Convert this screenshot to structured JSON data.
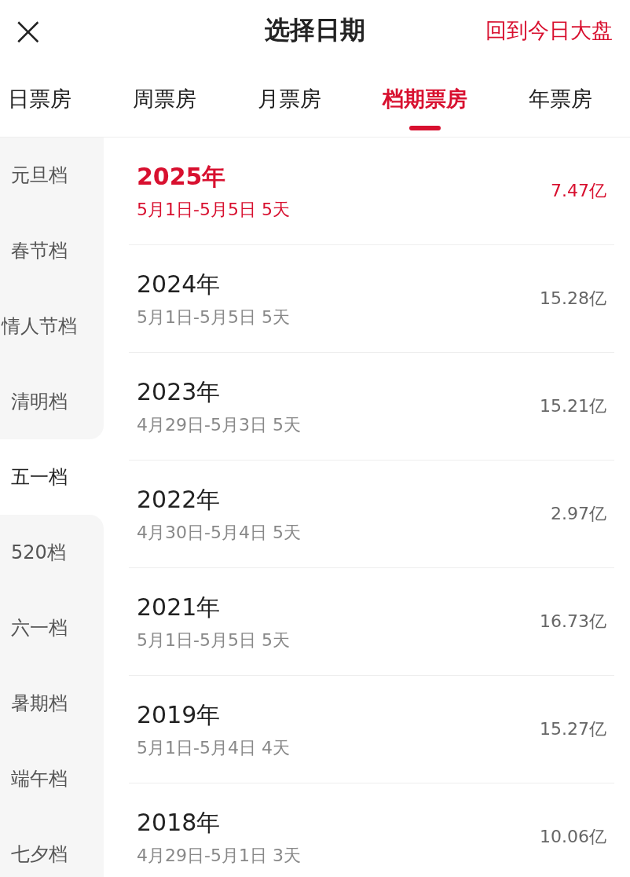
{
  "header": {
    "close": "×",
    "title": "选择日期",
    "link": "回到今日大盘"
  },
  "tabs": [
    {
      "label": "日票房",
      "selected": false
    },
    {
      "label": "周票房",
      "selected": false
    },
    {
      "label": "月票房",
      "selected": false
    },
    {
      "label": "档期票房",
      "selected": true
    },
    {
      "label": "年票房",
      "selected": false
    }
  ],
  "sidebar": {
    "items": [
      {
        "label": "元旦档",
        "selected": false
      },
      {
        "label": "春节档",
        "selected": false
      },
      {
        "label": "情人节档",
        "selected": false
      },
      {
        "label": "清明档",
        "selected": false
      },
      {
        "label": "五一档",
        "selected": true
      },
      {
        "label": "520档",
        "selected": false
      },
      {
        "label": "六一档",
        "selected": false
      },
      {
        "label": "暑期档",
        "selected": false
      },
      {
        "label": "端午档",
        "selected": false
      },
      {
        "label": "七夕档",
        "selected": false
      }
    ]
  },
  "rows": [
    {
      "year": "2025年",
      "dates": "5月1日-5月5日 5天",
      "box_office": "7.47亿",
      "selected": true
    },
    {
      "year": "2024年",
      "dates": "5月1日-5月5日 5天",
      "box_office": "15.28亿",
      "selected": false
    },
    {
      "year": "2023年",
      "dates": "4月29日-5月3日 5天",
      "box_office": "15.21亿",
      "selected": false
    },
    {
      "year": "2022年",
      "dates": "4月30日-5月4日 5天",
      "box_office": "2.97亿",
      "selected": false
    },
    {
      "year": "2021年",
      "dates": "5月1日-5月5日 5天",
      "box_office": "16.73亿",
      "selected": false
    },
    {
      "year": "2019年",
      "dates": "5月1日-5月4日 4天",
      "box_office": "15.27亿",
      "selected": false
    },
    {
      "year": "2018年",
      "dates": "4月29日-5月1日 3天",
      "box_office": "10.06亿",
      "selected": false
    }
  ]
}
